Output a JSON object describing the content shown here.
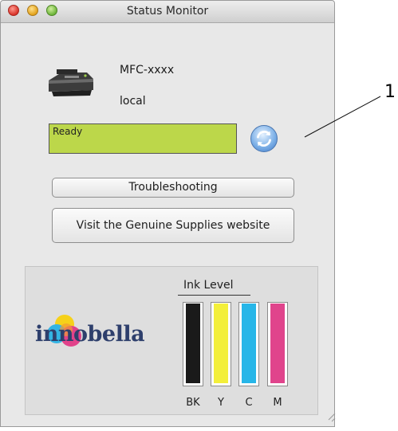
{
  "window": {
    "title": "Status Monitor"
  },
  "device": {
    "model": "MFC-xxxx",
    "location": "local",
    "icon": "printer-icon"
  },
  "status": {
    "text": "Ready",
    "color": "#bcd74a"
  },
  "refresh_icon": "refresh-icon",
  "buttons": {
    "troubleshooting": "Troubleshooting",
    "supplies": "Visit the Genuine Supplies website"
  },
  "ink": {
    "title": "Ink Level",
    "tanks": [
      {
        "label": "BK",
        "color": "#1a1a1a",
        "level": 1.0
      },
      {
        "label": "Y",
        "color": "#f3ef3a",
        "level": 1.0
      },
      {
        "label": "C",
        "color": "#27b6e8",
        "level": 1.0
      },
      {
        "label": "M",
        "color": "#e0448c",
        "level": 1.0
      }
    ]
  },
  "brand": {
    "name": "innobella"
  },
  "callout": {
    "number": "1"
  }
}
